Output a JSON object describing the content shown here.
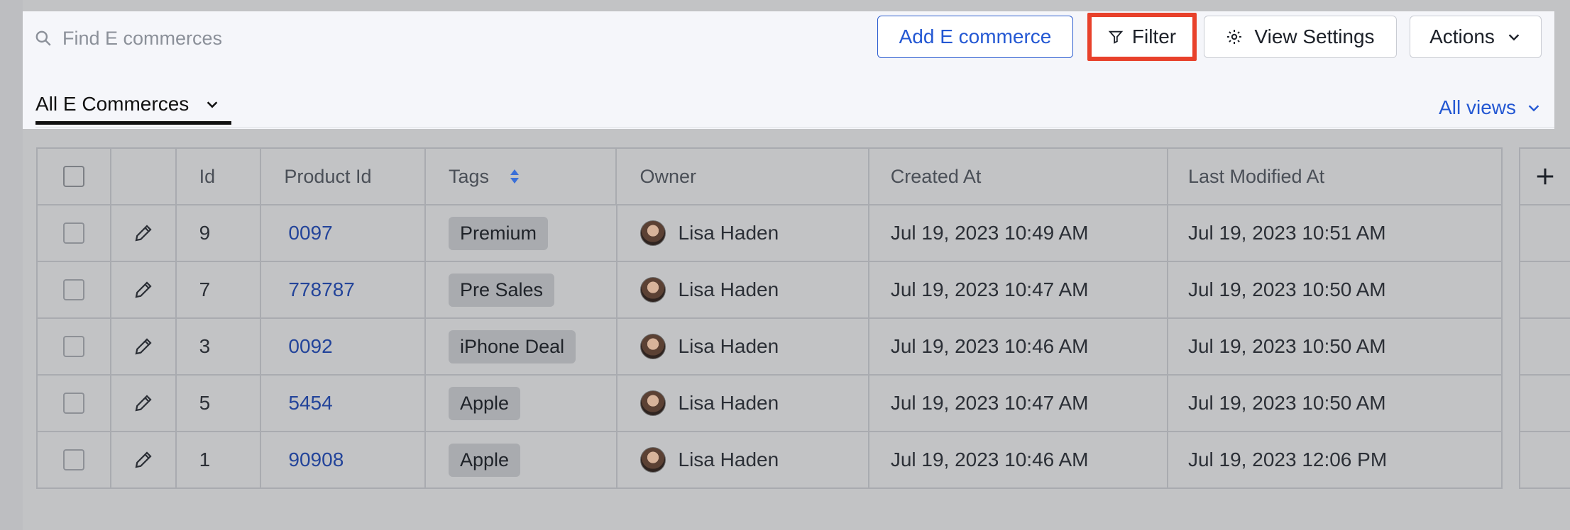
{
  "search": {
    "placeholder": "Find E commerces"
  },
  "toolbar": {
    "add_label": "Add E commerce",
    "filter_label": "Filter",
    "view_settings_label": "View Settings",
    "actions_label": "Actions"
  },
  "views": {
    "current": "All E Commerces",
    "all_views_label": "All views"
  },
  "table": {
    "columns": {
      "id": "Id",
      "product_id": "Product Id",
      "tags": "Tags",
      "owner": "Owner",
      "created_at": "Created At",
      "last_modified_at": "Last Modified At"
    },
    "rows": [
      {
        "id": "9",
        "product_id": "0097",
        "tag": "Premium",
        "owner": "Lisa Haden",
        "created_at": "Jul 19, 2023 10:49 AM",
        "last_modified_at": "Jul 19, 2023 10:51 AM"
      },
      {
        "id": "7",
        "product_id": "778787",
        "tag": "Pre Sales",
        "owner": "Lisa Haden",
        "created_at": "Jul 19, 2023 10:47 AM",
        "last_modified_at": "Jul 19, 2023 10:50 AM"
      },
      {
        "id": "3",
        "product_id": "0092",
        "tag": "iPhone Deal",
        "owner": "Lisa Haden",
        "created_at": "Jul 19, 2023 10:46 AM",
        "last_modified_at": "Jul 19, 2023 10:50 AM"
      },
      {
        "id": "5",
        "product_id": "5454",
        "tag": "Apple",
        "owner": "Lisa Haden",
        "created_at": "Jul 19, 2023 10:47 AM",
        "last_modified_at": "Jul 19, 2023 10:50 AM"
      },
      {
        "id": "1",
        "product_id": "90908",
        "tag": "Apple",
        "owner": "Lisa Haden",
        "created_at": "Jul 19, 2023 10:46 AM",
        "last_modified_at": "Jul 19, 2023 12:06 PM"
      }
    ]
  },
  "icons": {
    "search": "search-icon",
    "filter": "funnel-icon",
    "settings": "gear-icon",
    "chevron": "chevron-down-icon",
    "sort": "sort-icon",
    "edit": "pencil-icon",
    "add_column": "plus-icon"
  },
  "colors": {
    "accent": "#2458d3",
    "highlight": "#e8412b",
    "link": "#23449a"
  }
}
